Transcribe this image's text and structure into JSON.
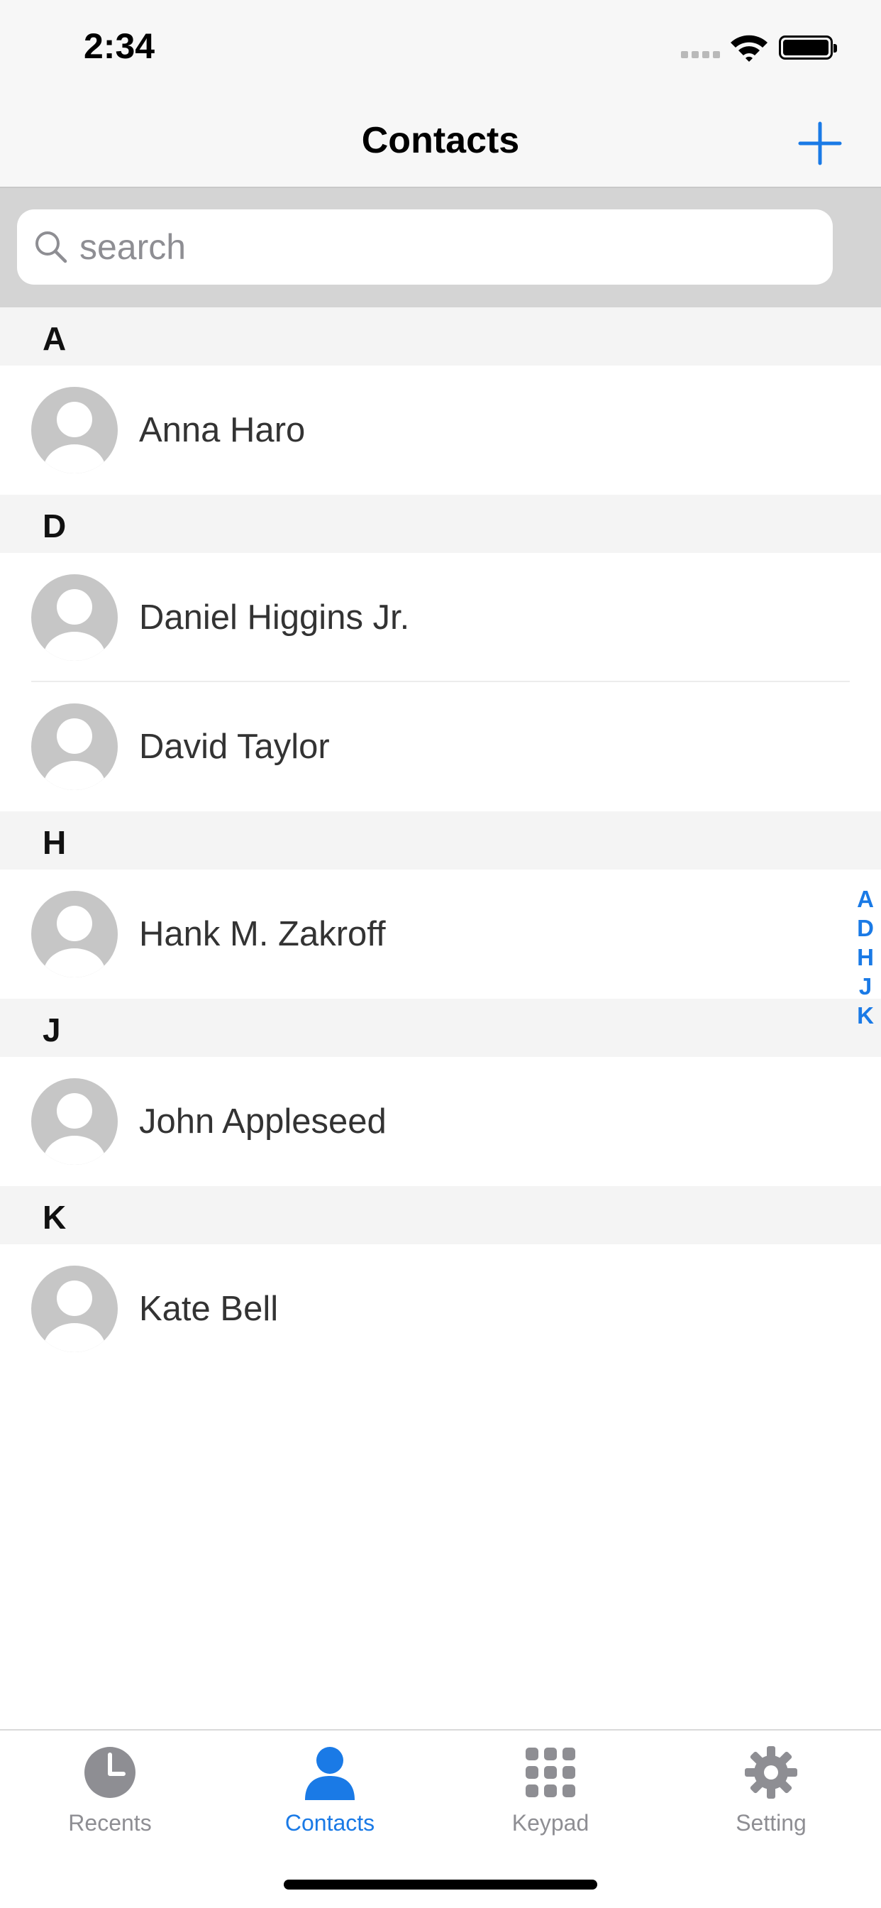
{
  "status_bar": {
    "time": "2:34"
  },
  "nav": {
    "title": "Contacts",
    "add_icon": "plus-icon"
  },
  "search": {
    "placeholder": "search",
    "value": ""
  },
  "colors": {
    "accent": "#1a7ae6",
    "inactive": "#8e8e93",
    "avatar": "#c6c6c6",
    "section_bg": "#f4f4f4"
  },
  "sections": [
    {
      "letter": "A",
      "contacts": [
        "Anna Haro"
      ]
    },
    {
      "letter": "D",
      "contacts": [
        "Daniel Higgins Jr.",
        "David Taylor"
      ]
    },
    {
      "letter": "H",
      "contacts": [
        "Hank M. Zakroff"
      ]
    },
    {
      "letter": "J",
      "contacts": [
        "John Appleseed"
      ]
    },
    {
      "letter": "K",
      "contacts": [
        "Kate Bell"
      ]
    }
  ],
  "section_index": [
    "A",
    "D",
    "H",
    "J",
    "K"
  ],
  "tabs": [
    {
      "label": "Recents",
      "icon": "clock-icon",
      "active": false
    },
    {
      "label": "Contacts",
      "icon": "person-icon",
      "active": true
    },
    {
      "label": "Keypad",
      "icon": "keypad-icon",
      "active": false
    },
    {
      "label": "Setting",
      "icon": "gear-icon",
      "active": false
    }
  ]
}
